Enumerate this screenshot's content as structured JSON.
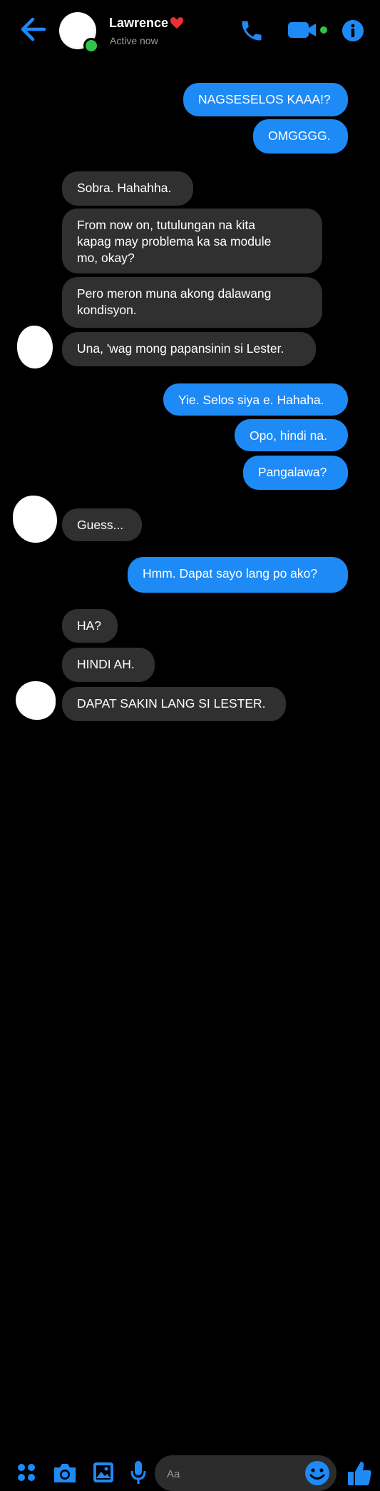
{
  "header": {
    "back_icon": "arrow-left-icon",
    "contact_name": "Lawrence",
    "name_emoji": "red-heart",
    "status": "Active now",
    "accent_color": "#1e8af6",
    "online_color": "#31c449",
    "actions": [
      "phone-icon",
      "video-camera-icon",
      "info-icon"
    ]
  },
  "messages": [
    {
      "sender": "me",
      "text": "NAGSESELOS KAAA!?"
    },
    {
      "sender": "me",
      "text": "OMGGGG."
    },
    {
      "sender": "them",
      "text": "Sobra. Hahahha."
    },
    {
      "sender": "them",
      "lines": [
        "From now on, tutulungan na kita",
        "kapag may problema ka sa module",
        "mo, okay?"
      ]
    },
    {
      "sender": "them",
      "lines": [
        "Pero meron muna akong dalawang",
        "kondisyon."
      ]
    },
    {
      "sender": "them",
      "text": "Una, 'wag mong papansinin si Lester."
    },
    {
      "sender": "me",
      "text": "Yie. Selos siya e. Hahaha."
    },
    {
      "sender": "me",
      "text": "Opo, hindi na."
    },
    {
      "sender": "me",
      "text": "Pangalawa?"
    },
    {
      "sender": "them",
      "text": "Guess..."
    },
    {
      "sender": "me",
      "text": "Hmm. Dapat sayo lang po ako?"
    },
    {
      "sender": "them",
      "text": "HA?"
    },
    {
      "sender": "them",
      "text": "HINDI AH."
    },
    {
      "sender": "them",
      "text": "DAPAT SAKIN LANG SI LESTER."
    }
  ],
  "composer": {
    "placeholder": "Aa",
    "icons": [
      "apps-icon",
      "camera-icon",
      "gallery-icon",
      "microphone-icon",
      "emoji-icon",
      "thumbs-up-icon"
    ]
  }
}
